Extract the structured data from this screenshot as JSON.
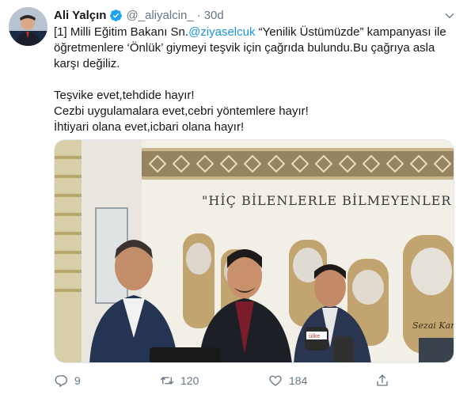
{
  "tweet": {
    "author_name": "Ali Yalçın",
    "handle": "@_aliyalcin_",
    "separator": "·",
    "time": "30d",
    "text_part1": "[1] Milli Eğitim Bakanı Sn.",
    "mention": "@ziyaselcuk",
    "text_part2": "  “Yenilik Üstümüzde” kampanyası ile öğretmenlere ‘Önlük’ giymeyi teşvik için çağrıda bulundu.Bu çağrıya asla karşı değiliz.",
    "line1": "Teşvike evet,tehdide hayır!",
    "line2": "Cezbi uygulamalara evet,cebri yöntemlere hayır!",
    "line3": "İhtiyari olana evet,icbari olana hayır!",
    "photo_banner_text": "\"HİÇ BİLENLERLE BİLMEYENLER BİR Ο",
    "photo_sign_text": "Sezai Karakoç",
    "photo_mic_text": "ülke"
  },
  "actions": {
    "reply_count": "9",
    "retweet_count": "120",
    "like_count": "184"
  },
  "colors": {
    "link": "#1b95e0",
    "secondary": "#657786",
    "verified": "#1da1f2"
  }
}
